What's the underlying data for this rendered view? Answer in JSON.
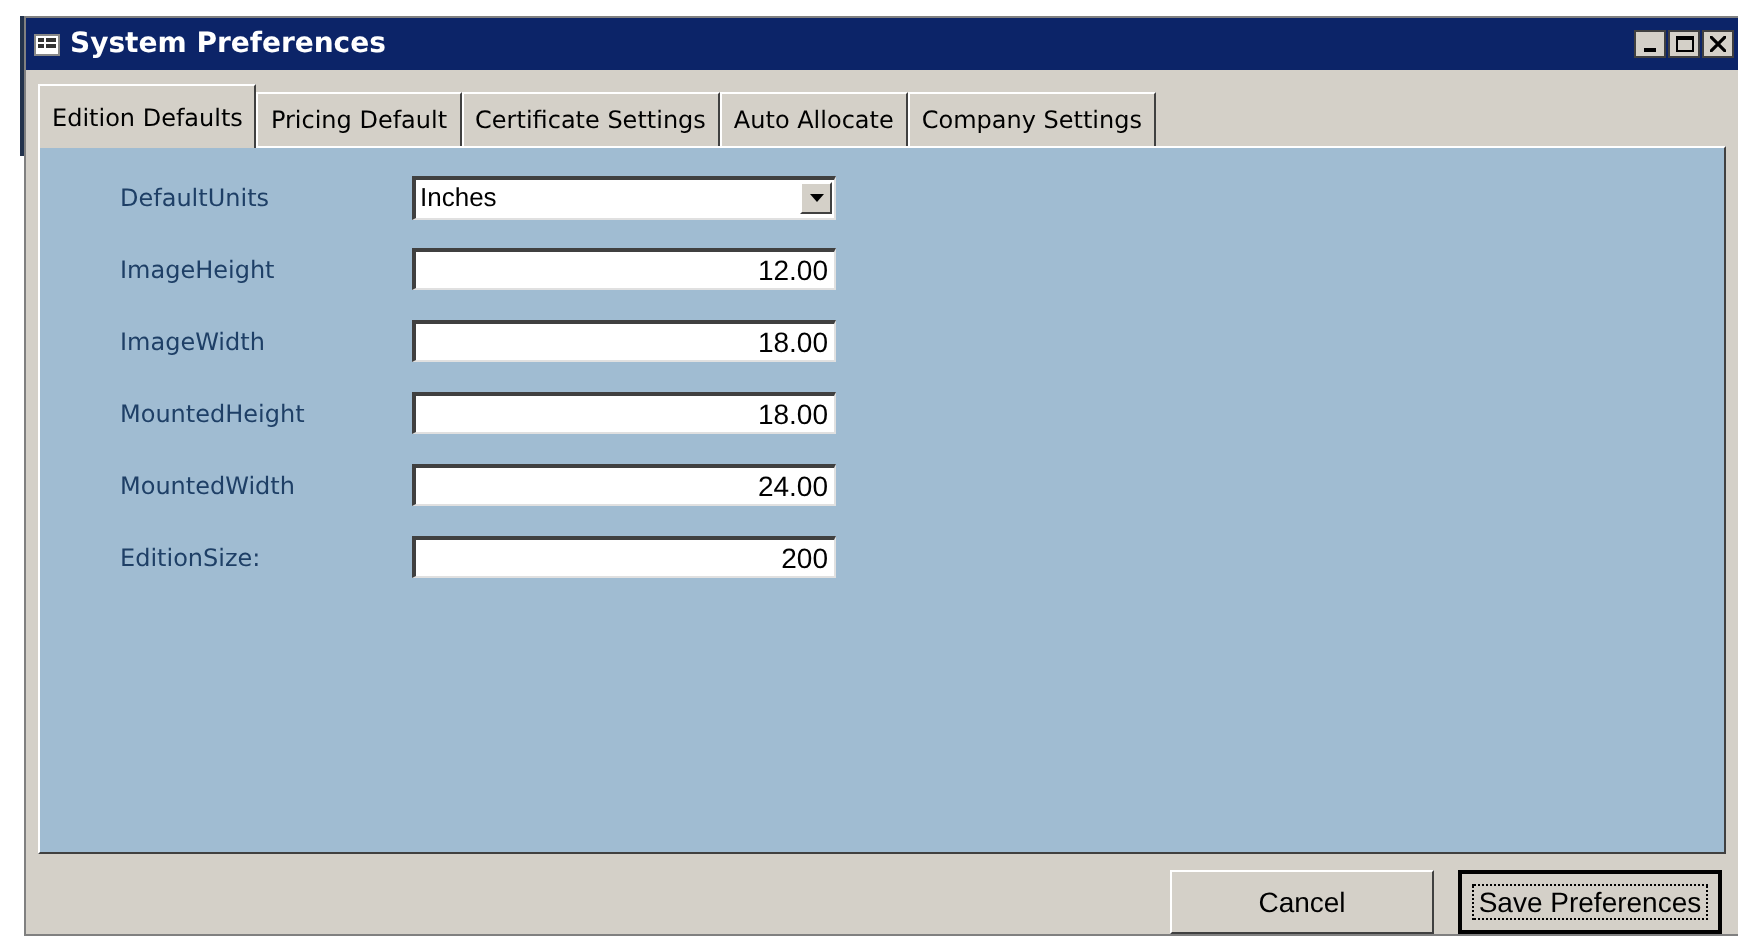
{
  "window": {
    "title": "System Preferences"
  },
  "tabs": [
    {
      "label": "Edition Defaults",
      "selected": true
    },
    {
      "label": "Pricing Default",
      "selected": false
    },
    {
      "label": "Certificate Settings",
      "selected": false
    },
    {
      "label": "Auto Allocate",
      "selected": false
    },
    {
      "label": "Company Settings",
      "selected": false
    }
  ],
  "fields": [
    {
      "kind": "dropdown",
      "label": "DefaultUnits",
      "value": "Inches"
    },
    {
      "kind": "number",
      "label": "ImageHeight",
      "value": "12.00"
    },
    {
      "kind": "number",
      "label": "ImageWidth",
      "value": "18.00"
    },
    {
      "kind": "number",
      "label": "MountedHeight",
      "value": "18.00"
    },
    {
      "kind": "number",
      "label": "MountedWidth",
      "value": "24.00"
    },
    {
      "kind": "number",
      "label": "EditionSize:",
      "value": "200"
    }
  ],
  "buttons": [
    {
      "label": "Cancel",
      "focused": false
    },
    {
      "label": "Save Preferences",
      "focused": true
    }
  ]
}
